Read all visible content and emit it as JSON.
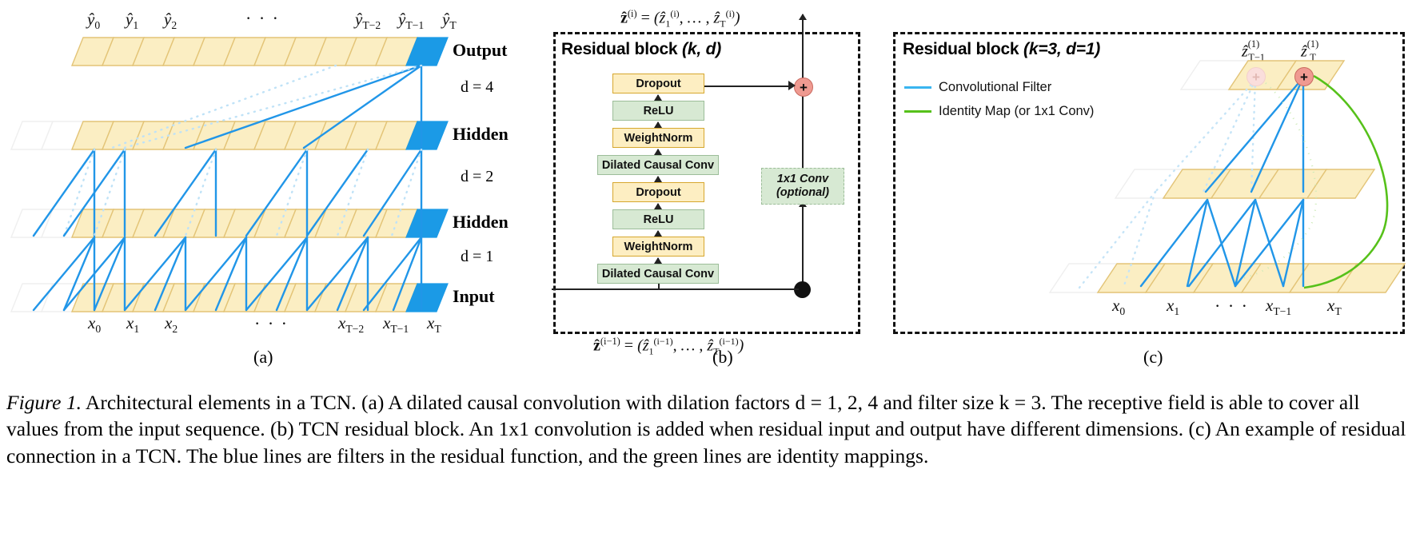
{
  "figure": {
    "number_label": "Figure 1.",
    "caption": " Architectural elements in a TCN. (a) A dilated causal convolution with dilation factors d = 1, 2, 4 and filter size k = 3. The receptive field is able to cover all values from the input sequence. (b) TCN residual block. An 1x1 convolution is added when residual input and output have different dimensions. (c) An example of residual connection in a TCN. The blue lines are filters in the residual function, and the green lines are identity mappings."
  },
  "subcaptions": {
    "a": "(a)",
    "b": "(b)",
    "c": "(c)"
  },
  "colors": {
    "cell_fill": "#fbeec3",
    "cell_border": "#e3c477",
    "highlight_blue": "#1b9ae6",
    "filter_blue": "#2196e8",
    "identity_green": "#56c11a",
    "box_yellow_fill": "#fdeec2",
    "box_yellow_border": "#d6a72e",
    "box_green_fill": "#d7e9d3",
    "box_green_border": "#9cbd99",
    "plus_node": "#ef9a91",
    "ghost_cell_border": "#eeeeee"
  },
  "panel_a": {
    "top_labels": [
      "ŷ0",
      "ŷ1",
      "ŷ2",
      "···",
      "ŷT−2",
      "ŷT−1",
      "ŷT"
    ],
    "bottom_labels": [
      "x0",
      "x1",
      "x2",
      "···",
      "xT−2",
      "xT−1",
      "xT"
    ],
    "layer_labels": [
      "Output",
      "Hidden",
      "Hidden",
      "Input"
    ],
    "dilation_labels": [
      "d = 4",
      "d = 2",
      "d = 1"
    ],
    "dilations": [
      4,
      2,
      1
    ],
    "kernel_size": 3,
    "num_cells": 11
  },
  "panel_b": {
    "title_prefix": "Residual block ",
    "title_params": "(k, d)",
    "top_formula": "ẑ(i) = (ẑ1(i), … , ẑT(i))",
    "bottom_formula": "ẑ(i−1) = (ẑ1(i−1), … , ẑT(i−1))",
    "stack": [
      "Dropout",
      "ReLU",
      "WeightNorm",
      "Dilated Causal Conv",
      "Dropout",
      "ReLU",
      "WeightNorm",
      "Dilated Causal Conv"
    ],
    "stack_colors": [
      "yellow",
      "green",
      "yellow",
      "green",
      "yellow",
      "green",
      "yellow",
      "green"
    ],
    "side_box_line1": "1x1 Conv",
    "side_box_line2": "(optional)",
    "add_node": "+"
  },
  "panel_c": {
    "title_prefix": "Residual block ",
    "title_params": "(k=3, d=1)",
    "legend": [
      {
        "label": "Convolutional Filter",
        "color": "#39b5f0"
      },
      {
        "label": "Identity Map (or 1x1 Conv)",
        "color": "#56c11a"
      }
    ],
    "top_labels": [
      "ẑT−1(1)",
      "ẑT(1)"
    ],
    "bottom_labels": [
      "x0",
      "x1",
      "···",
      "xT−1",
      "xT"
    ],
    "add_node": "+"
  }
}
